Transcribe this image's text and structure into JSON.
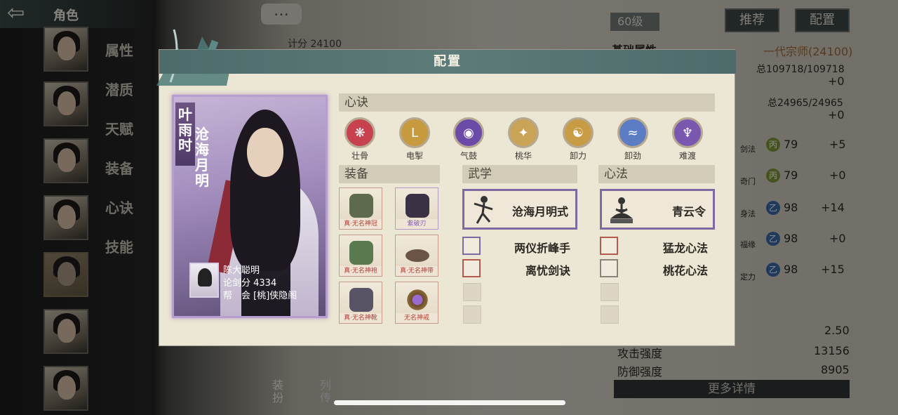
{
  "header": {
    "title": "角色"
  },
  "side_tabs": [
    "属性",
    "潜质",
    "天赋",
    "装备",
    "心诀",
    "技能"
  ],
  "chat": {
    "icon": "…"
  },
  "score_top": "计分 24100",
  "right_panel": {
    "level": "60级",
    "btn_recommend": "推荐",
    "btn_config": "配置",
    "base_attr": "基础属性",
    "rank": "一代宗师(24100)",
    "total1": "总109718/109718",
    "plus1": "+0",
    "total2": "总24965/24965",
    "plus2": "+0",
    "rows": [
      {
        "label": "剑法",
        "grade": "丙",
        "value": "79",
        "bonus": "+5"
      },
      {
        "label": "奇门",
        "grade": "丙",
        "value": "79",
        "bonus": "+0"
      },
      {
        "label": "身法",
        "grade": "乙",
        "value": "98",
        "bonus": "+14"
      },
      {
        "label": "福缘",
        "grade": "乙",
        "value": "98",
        "bonus": "+0"
      },
      {
        "label": "定力",
        "grade": "乙",
        "value": "98",
        "bonus": "+15"
      }
    ],
    "stat1_value": "2.50",
    "attack_label": "攻击强度",
    "attack_value": "13156",
    "defense_label": "防御强度",
    "defense_value": "8905",
    "more": "更多详情"
  },
  "bottom_tabs": {
    "dress": "装扮",
    "biography": "列传"
  },
  "modal": {
    "title": "配置",
    "character": {
      "name": "叶雨时",
      "style": "沧海月明",
      "player": "陈大聪明",
      "score": "论剑分 4334",
      "guild": "帮　会 [桃]侠隐阁"
    },
    "xinjue_header": "心诀",
    "xinjue": [
      {
        "label": "壮骨",
        "color": "#c8414f",
        "icon": "❋"
      },
      {
        "label": "电掣",
        "color": "#c79a3e",
        "icon": "L"
      },
      {
        "label": "气鼓",
        "color": "#6c4aa8",
        "icon": "◉"
      },
      {
        "label": "桃华",
        "color": "#c9a456",
        "icon": "✦"
      },
      {
        "label": "卸力",
        "color": "#c89b45",
        "icon": "☯"
      },
      {
        "label": "卸劲",
        "color": "#5c7cc4",
        "icon": "≈"
      },
      {
        "label": "难渡",
        "color": "#7a58b0",
        "icon": "♆"
      }
    ],
    "equip_header": "装备",
    "equips": [
      {
        "label": "真·无名神冠",
        "color": "#5d6a4c"
      },
      {
        "label": "紫破刃",
        "color": "#3a3144"
      },
      {
        "label": "真·无名神袍",
        "color": "#5a7a50"
      },
      {
        "label": "真·无名神带",
        "color": "#6a5446"
      },
      {
        "label": "真·无名神靴",
        "color": "#595366"
      },
      {
        "label": "无名神戒",
        "color": "#7a4ea6"
      }
    ],
    "martial_header": "武学",
    "martial_main": "沧海月明式",
    "martial_subs": [
      "两仪折峰手",
      "离忧剑诀"
    ],
    "mind_header": "心法",
    "mind_main": "青云令",
    "mind_subs": [
      "猛龙心法",
      "桃花心法"
    ]
  }
}
